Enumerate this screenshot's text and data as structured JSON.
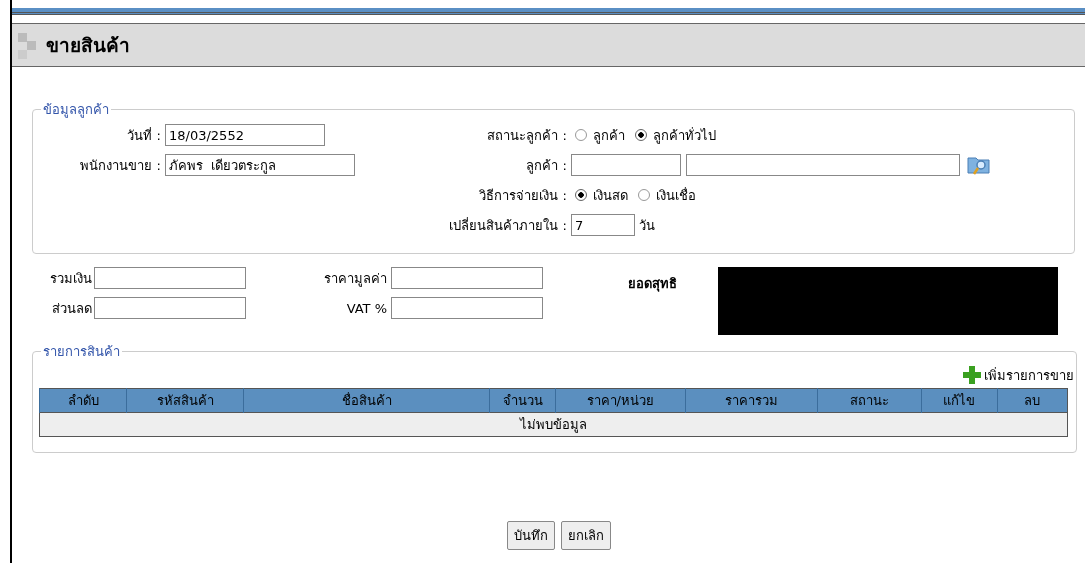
{
  "page_title": "ขายสินค้า",
  "customer_info": {
    "legend": "ข้อมูลลูกค้า",
    "date": {
      "label": "วันที่ :",
      "value": "18/03/2552"
    },
    "salesperson": {
      "label": "พนักงานขาย :",
      "value": "ภัคพร  เดียวตระกูล"
    },
    "customer_status": {
      "label": "สถานะลูกค้า :",
      "options": [
        {
          "label": "ลูกค้า",
          "selected": false
        },
        {
          "label": "ลูกค้าทั่วไป",
          "selected": true
        }
      ]
    },
    "customer": {
      "label": "ลูกค้า :"
    },
    "payment_method": {
      "label": "วิธีการจ่ายเงิน :",
      "options": [
        {
          "label": "เงินสด",
          "selected": true
        },
        {
          "label": "เงินเชื่อ",
          "selected": false
        }
      ]
    },
    "exchange_within": {
      "label": "เปลี่ยนสินค้าภายใน :",
      "value": "7",
      "unit": "วัน"
    }
  },
  "totals": {
    "sum": {
      "label": "รวมเงิน"
    },
    "value_price": {
      "label": "ราคามูลค่า"
    },
    "net_total": {
      "label": "ยอดสุทธิ"
    },
    "discount": {
      "label": "ส่วนลด"
    },
    "vat": {
      "label": "VAT %"
    }
  },
  "items": {
    "legend": "รายการสินค้า",
    "add_link": "เพิ่มรายการขาย",
    "columns": [
      "ลำดับ",
      "รหัสสินค้า",
      "ชื่อสินค้า",
      "จำนวน",
      "ราคา/หน่วย",
      "ราคารวม",
      "สถานะ",
      "แก้ไข",
      "ลบ"
    ],
    "empty_message": "ไม่พบข้อมูล"
  },
  "buttons": [
    "บันทึก",
    "ยกเลิก"
  ]
}
